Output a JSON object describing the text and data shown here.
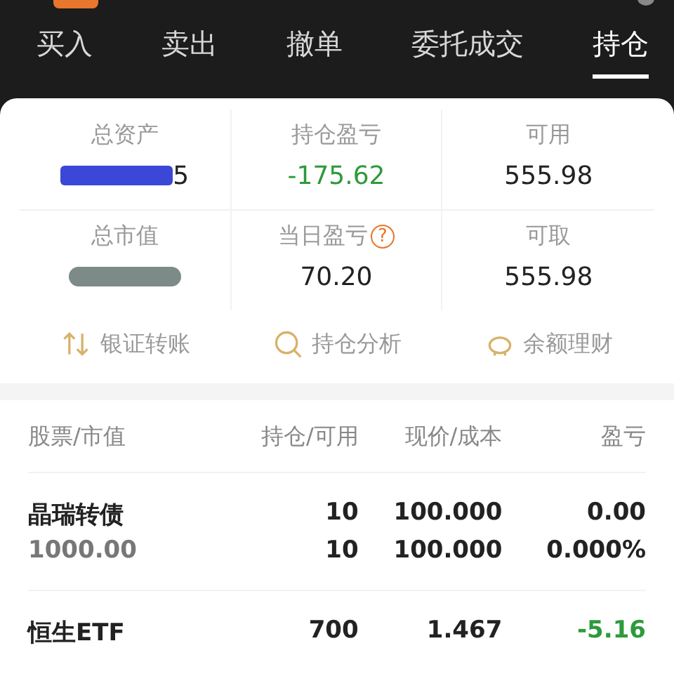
{
  "tabs": [
    {
      "label": "买入",
      "selected": false
    },
    {
      "label": "卖出",
      "selected": false
    },
    {
      "label": "撤单",
      "selected": false
    },
    {
      "label": "委托成交",
      "selected": false
    },
    {
      "label": "持仓",
      "selected": true
    }
  ],
  "summary": [
    {
      "label": "总资产",
      "value": "5",
      "redacted": true,
      "color": "#222222"
    },
    {
      "label": "持仓盈亏",
      "value": "-175.62",
      "color": "#2f9a3c"
    },
    {
      "label": "可用",
      "value": "555.98",
      "color": "#222222"
    },
    {
      "label": "总市值",
      "redacted": true
    },
    {
      "label": "当日盈亏",
      "value": "70.20",
      "color": "#222222",
      "help": "?"
    },
    {
      "label": "可取",
      "value": "555.98",
      "color": "#222222"
    }
  ],
  "actions": [
    {
      "label": "银证转账",
      "kind": "transfer"
    },
    {
      "label": "持仓分析",
      "kind": "analysis"
    },
    {
      "label": "余额理财",
      "kind": "savings"
    }
  ],
  "table": {
    "columns": [
      "股票/市值",
      "持仓/可用",
      "现价/成本",
      "盈亏"
    ],
    "rows": [
      {
        "name": "晶瑞转债",
        "market_value": "1000.00",
        "holding": "10",
        "available": "10",
        "price": "100.000",
        "cost": "100.000",
        "pnl": "0.00",
        "pnl_pct": "0.000%",
        "color": "#222222"
      },
      {
        "name": "恒生ETF",
        "holding": "700",
        "price": "1.467",
        "pnl": "-5.16",
        "color": "#2f9a3c"
      }
    ]
  }
}
